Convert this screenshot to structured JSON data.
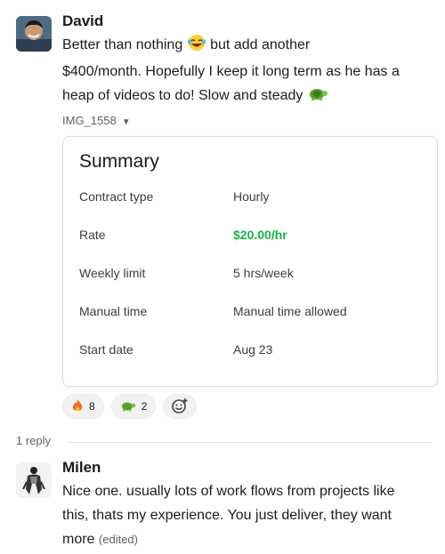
{
  "messages": [
    {
      "author": "David",
      "text_line1": "Better than nothing",
      "text_line1b": "but add another",
      "text_line2": "$400/month. Hopefully I keep it long term as he has a",
      "text_line3": "heap of videos to do! Slow and steady",
      "attachment_name": "IMG_1558"
    },
    {
      "author": "Milen",
      "text_line1": "Nice one. usually lots of work flows from projects like",
      "text_line2": "this, thats my experience. You just deliver, they want",
      "text_line3": "more",
      "edited_label": "(edited)"
    }
  ],
  "summary_card": {
    "title": "Summary",
    "rows": [
      {
        "label": "Contract type",
        "value": "Hourly"
      },
      {
        "label": "Rate",
        "value": "$20.00/hr"
      },
      {
        "label": "Weekly limit",
        "value": "5 hrs/week"
      },
      {
        "label": "Manual time",
        "value": "Manual time allowed"
      },
      {
        "label": "Start date",
        "value": "Aug 23"
      }
    ],
    "rate_color": "#12b347"
  },
  "reactions": [
    {
      "emoji": "fire-icon",
      "count": "8"
    },
    {
      "emoji": "turtle-icon",
      "count": "2"
    }
  ],
  "thread": {
    "reply_count": "1 reply"
  },
  "icons": {
    "laughing": "laughing-emoji-icon",
    "turtle": "turtle-icon",
    "fire": "fire-icon",
    "add_reaction": "add-reaction-icon",
    "caret": "caret-down-icon"
  }
}
